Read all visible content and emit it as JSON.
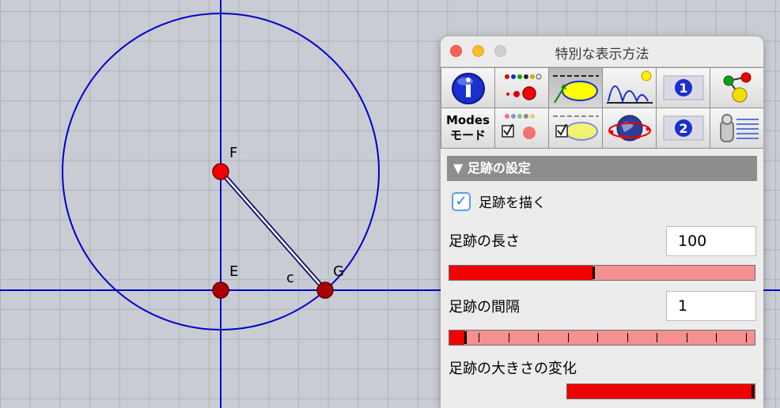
{
  "canvas": {
    "points": [
      {
        "id": "F",
        "label": "F"
      },
      {
        "id": "E",
        "label": "E"
      },
      {
        "id": "G",
        "label": "G"
      }
    ],
    "segment_label": "c",
    "colors": {
      "axis": "#0000cc",
      "circle": "#0000cc",
      "point_fill": "#f00000",
      "point_dark": "#aa0000",
      "segment": "#0a0a6e"
    }
  },
  "palette": {
    "title": "特別な表示方法",
    "tools_row1": [
      {
        "name": "info-icon"
      },
      {
        "name": "color-dots-icon"
      },
      {
        "name": "ellipse-trace-icon"
      },
      {
        "name": "bounce-trace-icon"
      },
      {
        "name": "page-one-icon"
      },
      {
        "name": "molecule-icon"
      }
    ],
    "tools_row2": [
      {
        "name": "modes-icon",
        "line1": "Modes",
        "line2": "モード"
      },
      {
        "name": "checkbox-dots-icon"
      },
      {
        "name": "checkbox-ellipse-icon"
      },
      {
        "name": "globe-icon"
      },
      {
        "name": "page-two-icon"
      },
      {
        "name": "list-clip-icon"
      }
    ],
    "section_title": "▼ 足跡の設定",
    "draw_trace": {
      "label": "足跡を描く",
      "checked": true,
      "check_glyph": "✓"
    },
    "trace_length": {
      "label": "足跡の長さ",
      "value": "100",
      "slider_fraction": 0.47
    },
    "trace_interval": {
      "label": "足跡の間隔",
      "value": "1",
      "slider_fraction": 0.05
    },
    "trace_size_change": {
      "label": "足跡の大きさの変化",
      "slider_fraction": 1.0
    },
    "accent_colors": {
      "slider_fill": "#f00000",
      "slider_track": "#f59090",
      "header_bg": "#8d8d8d"
    }
  }
}
